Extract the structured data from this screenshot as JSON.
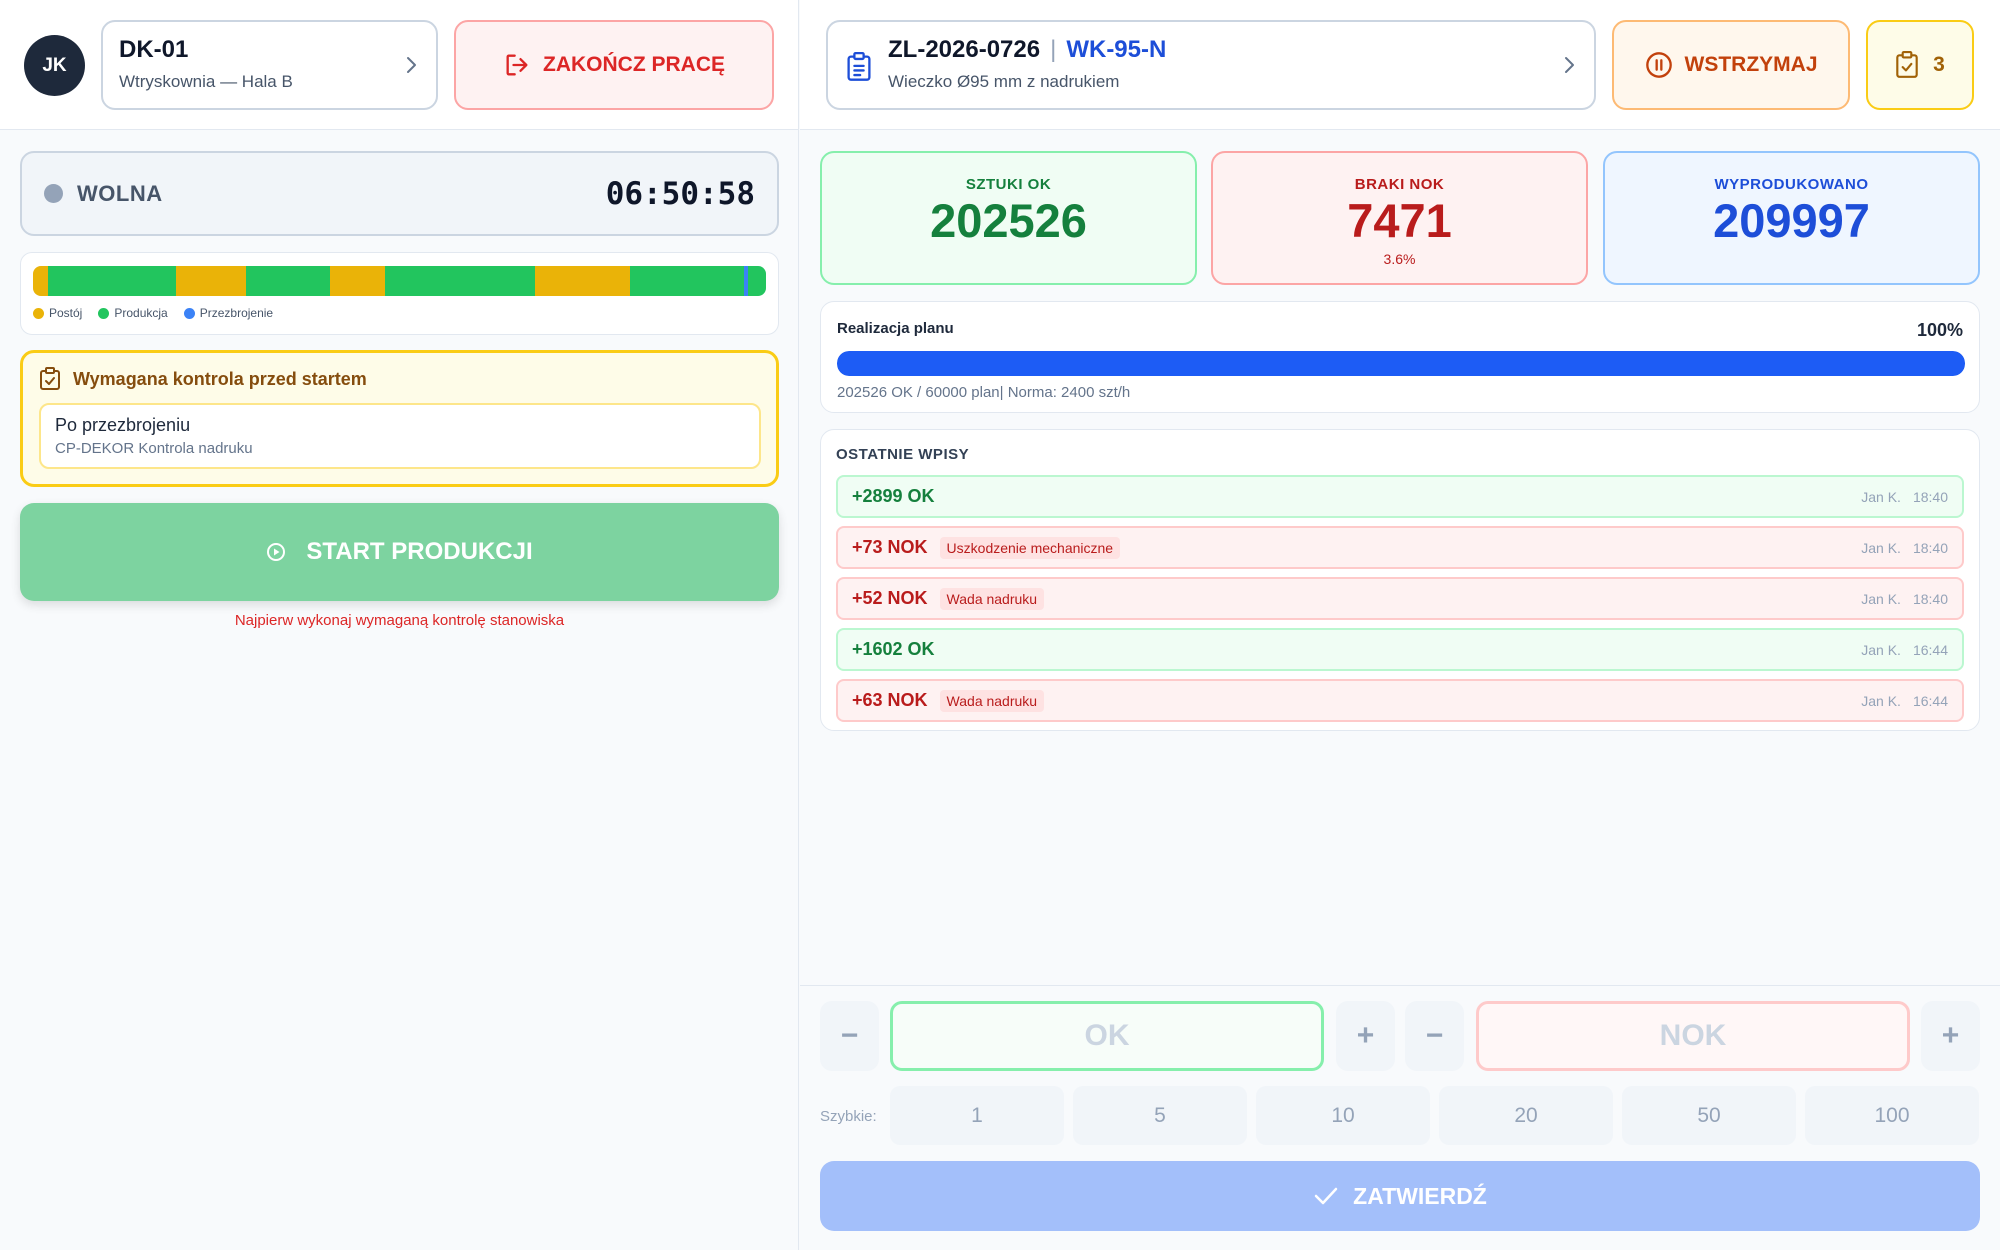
{
  "operator": {
    "initials": "JK"
  },
  "station": {
    "code": "DK-01",
    "location": "Wtryskownia — Hala B"
  },
  "end_work_label": "ZAKOŃCZ PRACĘ",
  "status": {
    "label": "WOLNA",
    "timer": "06:50:58",
    "dot_color": "#94a3b8"
  },
  "timeline": {
    "segments": [
      {
        "state": "Postój",
        "fraction": 0.02
      },
      {
        "state": "Produkcja",
        "fraction": 0.175
      },
      {
        "state": "Postój",
        "fraction": 0.095
      },
      {
        "state": "Produkcja",
        "fraction": 0.115
      },
      {
        "state": "Postój",
        "fraction": 0.075
      },
      {
        "state": "Produkcja",
        "fraction": 0.205
      },
      {
        "state": "Postój",
        "fraction": 0.13
      },
      {
        "state": "Produkcja",
        "fraction": 0.155
      },
      {
        "state": "Przezbrojenie",
        "fraction": 0.005
      },
      {
        "state": "Produkcja",
        "fraction": 0.025
      }
    ],
    "legend": [
      {
        "label": "Postój",
        "color": "#eab308"
      },
      {
        "label": "Produkcja",
        "color": "#22c55e"
      },
      {
        "label": "Przezbrojenie",
        "color": "#3b82f6"
      }
    ]
  },
  "pre_start_check": {
    "title": "Wymagana kontrola przed startem",
    "item_name": "Po przezbrojeniu",
    "item_code": "CP-DEKOR Kontrola nadruku"
  },
  "start_button_label": "START PRODUKCJI",
  "start_warning": "Najpierw wykonaj wymaganą kontrolę stanowiska",
  "order": {
    "number": "ZL-2026-0726",
    "separator": "|",
    "product_code": "WK-95-N",
    "description": "Wieczko Ø95 mm z nadrukiem"
  },
  "pause_label": "WSTRZYMAJ",
  "tasks_count": "3",
  "stats": {
    "ok": {
      "label": "SZTUKI OK",
      "value": "202526"
    },
    "nok": {
      "label": "BRAKI NOK",
      "value": "7471",
      "percent": "3.6%"
    },
    "total": {
      "label": "WYPRODUKOWANO",
      "value": "209997"
    }
  },
  "plan": {
    "label": "Realizacja planu",
    "percent_text": "100%",
    "fill_fraction": 1.0,
    "note": "202526 OK / 60000 plan| Norma: 2400 szt/h",
    "color": "#1d5cf5"
  },
  "entries": {
    "title": "OSTATNIE WPISY",
    "items": [
      {
        "type": "ok",
        "qty": "+2899 OK",
        "reason": "",
        "user": "Jan K.",
        "time": "18:40"
      },
      {
        "type": "nok",
        "qty": "+73 NOK",
        "reason": "Uszkodzenie mechaniczne",
        "user": "Jan K.",
        "time": "18:40"
      },
      {
        "type": "nok",
        "qty": "+52 NOK",
        "reason": "Wada nadruku",
        "user": "Jan K.",
        "time": "18:40"
      },
      {
        "type": "ok",
        "qty": "+1602 OK",
        "reason": "",
        "user": "Jan K.",
        "time": "16:44"
      },
      {
        "type": "nok",
        "qty": "+63 NOK",
        "reason": "Wada nadruku",
        "user": "Jan K.",
        "time": "16:44"
      }
    ]
  },
  "input": {
    "ok_placeholder": "OK",
    "nok_placeholder": "NOK",
    "minus": "−",
    "plus": "+",
    "quick_label": "Szybkie:",
    "quick_values": [
      "1",
      "5",
      "10",
      "20",
      "50",
      "100"
    ],
    "confirm_label": "ZATWIERDŹ"
  }
}
